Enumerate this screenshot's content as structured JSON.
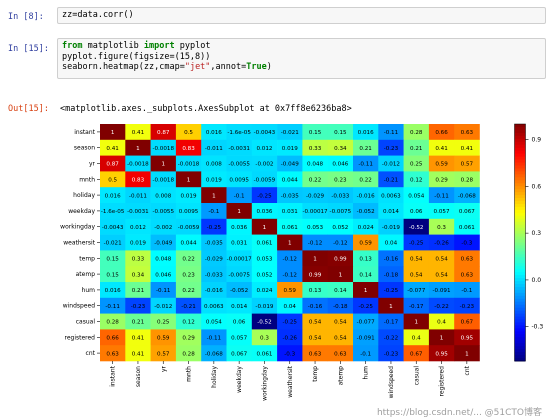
{
  "cells": [
    {
      "prompt": "In  [8]:",
      "code": "zz=data.corr()"
    },
    {
      "prompt": "In  [15]:",
      "lines": [
        [
          {
            "t": "from",
            "k": true
          },
          {
            "t": " matplotlib "
          },
          {
            "t": "import",
            "k": true
          },
          {
            "t": " pyplot"
          }
        ],
        [
          {
            "t": "pyplot.figure(figsize=(15,8))"
          }
        ],
        [
          {
            "t": "seaborn.heatmap(zz,cmap="
          },
          {
            "t": "\"jet\"",
            "s": true
          },
          {
            "t": ",annot="
          },
          {
            "t": "True",
            "k": true
          },
          {
            "t": ")"
          }
        ]
      ]
    }
  ],
  "output": {
    "prompt": "Out[15]:",
    "text": "<matplotlib.axes._subplots.AxesSubplot at 0x7ff8e6236ba8>"
  },
  "watermark": "https://blog.csdn.net/...  @51CTO博客",
  "chart_data": {
    "type": "heatmap",
    "colormap": "jet",
    "vmin": -0.52,
    "vmax": 1.0,
    "labels": [
      "instant",
      "season",
      "yr",
      "mnth",
      "holiday",
      "weekday",
      "workingday",
      "weathersit",
      "temp",
      "atemp",
      "hum",
      "windspeed",
      "casual",
      "registered",
      "cnt"
    ],
    "values": [
      [
        1,
        0.41,
        0.87,
        0.5,
        0.016,
        -1.6e-05,
        -0.0043,
        -0.021,
        0.15,
        0.15,
        0.016,
        -0.11,
        0.28,
        0.66,
        0.63
      ],
      [
        0.41,
        1,
        -0.0018,
        0.83,
        -0.011,
        -0.0031,
        0.012,
        0.019,
        0.33,
        0.34,
        0.21,
        -0.23,
        0.21,
        0.41,
        0.41
      ],
      [
        0.87,
        -0.0018,
        1,
        -0.0018,
        0.008,
        -0.0055,
        -0.002,
        -0.049,
        0.048,
        0.046,
        -0.11,
        -0.012,
        0.25,
        0.59,
        0.57
      ],
      [
        0.5,
        0.83,
        -0.0018,
        1,
        0.019,
        0.0095,
        -0.0059,
        0.044,
        0.22,
        0.23,
        0.22,
        -0.21,
        0.12,
        0.29,
        0.28
      ],
      [
        0.016,
        -0.011,
        0.008,
        0.019,
        1,
        -0.1,
        -0.25,
        -0.035,
        -0.029,
        -0.033,
        -0.016,
        0.0063,
        0.054,
        -0.11,
        -0.068
      ],
      [
        -1.6e-05,
        -0.0031,
        -0.0055,
        0.0095,
        -0.1,
        1,
        0.036,
        0.031,
        -0.00017,
        -0.0075,
        -0.052,
        0.014,
        0.06,
        0.057,
        0.067
      ],
      [
        -0.0043,
        0.012,
        -0.002,
        -0.0059,
        -0.25,
        0.036,
        1,
        0.061,
        0.053,
        0.052,
        0.024,
        -0.019,
        -0.52,
        0.3,
        0.061
      ],
      [
        -0.021,
        0.019,
        -0.049,
        0.044,
        -0.035,
        0.031,
        0.061,
        1,
        -0.12,
        -0.12,
        0.59,
        0.04,
        -0.25,
        -0.26,
        -0.3
      ],
      [
        0.15,
        0.33,
        0.048,
        0.22,
        -0.029,
        -0.00017,
        0.053,
        -0.12,
        1,
        0.99,
        0.13,
        -0.16,
        0.54,
        0.54,
        0.63
      ],
      [
        0.15,
        0.34,
        0.046,
        0.23,
        -0.033,
        -0.0075,
        0.052,
        -0.12,
        0.99,
        1,
        0.14,
        -0.18,
        0.54,
        0.54,
        0.63
      ],
      [
        0.016,
        0.21,
        -0.11,
        0.22,
        -0.016,
        -0.052,
        0.024,
        0.59,
        0.13,
        0.14,
        1,
        -0.25,
        -0.077,
        -0.091,
        -0.1
      ],
      [
        -0.11,
        -0.23,
        -0.012,
        -0.21,
        0.0063,
        0.014,
        -0.019,
        0.04,
        -0.16,
        -0.18,
        -0.25,
        1,
        -0.17,
        -0.22,
        -0.23
      ],
      [
        0.28,
        0.21,
        0.25,
        0.12,
        0.054,
        0.06,
        -0.52,
        -0.25,
        0.54,
        0.54,
        -0.077,
        -0.17,
        1,
        0.4,
        0.67
      ],
      [
        0.66,
        0.41,
        0.59,
        0.29,
        -0.11,
        0.057,
        0.3,
        -0.26,
        0.54,
        0.54,
        -0.091,
        -0.22,
        0.4,
        1,
        0.95
      ],
      [
        0.63,
        0.41,
        0.57,
        0.28,
        -0.068,
        0.067,
        0.061,
        -0.3,
        0.63,
        0.63,
        -0.1,
        -0.23,
        0.67,
        0.95,
        1
      ]
    ],
    "annotations": [
      [
        "1",
        "0.41",
        "0.87",
        "0.5",
        "0.016",
        "-1.6e-05",
        "-0.0043",
        "-0.021",
        "0.15",
        "0.15",
        "0.016",
        "-0.11",
        "0.28",
        "0.66",
        "0.63"
      ],
      [
        "0.41",
        "1",
        "-0.0018",
        "0.83",
        "-0.011",
        "-0.0031",
        "0.012",
        "0.019",
        "0.33",
        "0.34",
        "0.21",
        "-0.23",
        "0.21",
        "0.41",
        "0.41"
      ],
      [
        "0.87",
        "-0.0018",
        "1",
        "-0.0018",
        "0.008",
        "-0.0055",
        "-0.002",
        "-0.049",
        "0.048",
        "0.046",
        "-0.11",
        "-0.012",
        "0.25",
        "0.59",
        "0.57"
      ],
      [
        "0.5",
        "0.83",
        "-0.0018",
        "1",
        "0.019",
        "0.0095",
        "-0.0059",
        "0.044",
        "0.22",
        "0.23",
        "0.22",
        "-0.21",
        "0.12",
        "0.29",
        "0.28"
      ],
      [
        "0.016",
        "-0.011",
        "0.008",
        "0.019",
        "1",
        "-0.1",
        "-0.25",
        "-0.035",
        "-0.029",
        "-0.033",
        "-0.016",
        "0.0063",
        "0.054",
        "-0.11",
        "-0.068"
      ],
      [
        "-1.6e-05",
        "-0.0031",
        "-0.0055",
        "0.0095",
        "-0.1",
        "1",
        "0.036",
        "0.031",
        "-0.00017",
        "-0.0075",
        "-0.052",
        "0.014",
        "0.06",
        "0.057",
        "0.067"
      ],
      [
        "-0.0043",
        "0.012",
        "-0.002",
        "-0.0059",
        "-0.25",
        "0.036",
        "1",
        "0.061",
        "0.053",
        "0.052",
        "0.024",
        "-0.019",
        "-0.52",
        "0.3",
        "0.061"
      ],
      [
        "-0.021",
        "0.019",
        "-0.049",
        "0.044",
        "-0.035",
        "0.031",
        "0.061",
        "1",
        "-0.12",
        "-0.12",
        "0.59",
        "0.04",
        "-0.25",
        "-0.26",
        "-0.3"
      ],
      [
        "0.15",
        "0.33",
        "0.048",
        "0.22",
        "-0.029",
        "-0.00017",
        "0.053",
        "-0.12",
        "1",
        "0.99",
        "0.13",
        "-0.16",
        "0.54",
        "0.54",
        "0.63"
      ],
      [
        "0.15",
        "0.34",
        "0.046",
        "0.23",
        "-0.033",
        "-0.0075",
        "0.052",
        "-0.12",
        "0.99",
        "1",
        "0.14",
        "-0.18",
        "0.54",
        "0.54",
        "0.63"
      ],
      [
        "0.016",
        "0.21",
        "-0.11",
        "0.22",
        "-0.016",
        "-0.052",
        "0.024",
        "0.59",
        "0.13",
        "0.14",
        "1",
        "-0.25",
        "-0.077",
        "-0.091",
        "-0.1"
      ],
      [
        "-0.11",
        "-0.23",
        "-0.012",
        "-0.21",
        "0.0063",
        "0.014",
        "-0.019",
        "0.04",
        "-0.16",
        "-0.18",
        "-0.25",
        "1",
        "-0.17",
        "-0.22",
        "-0.23"
      ],
      [
        "0.28",
        "0.21",
        "0.25",
        "0.12",
        "0.054",
        "0.06",
        "-0.52",
        "-0.25",
        "0.54",
        "0.54",
        "-0.077",
        "-0.17",
        "1",
        "0.4",
        "0.67"
      ],
      [
        "0.66",
        "0.41",
        "0.59",
        "0.29",
        "-0.11",
        "0.057",
        "0.3",
        "-0.26",
        "0.54",
        "0.54",
        "-0.091",
        "-0.22",
        "0.4",
        "1",
        "0.95"
      ],
      [
        "0.63",
        "0.41",
        "0.57",
        "0.28",
        "-0.068",
        "0.067",
        "0.061",
        "-0.3",
        "0.63",
        "0.63",
        "-0.1",
        "-0.23",
        "0.67",
        "0.95",
        "1"
      ]
    ],
    "colorbar_ticks": [
      0.9,
      0.6,
      0.3,
      0.0,
      -0.3
    ],
    "colorbar_tick_labels": [
      "0.9",
      "0.6",
      "0.3",
      "0.0",
      "-0.3"
    ]
  }
}
